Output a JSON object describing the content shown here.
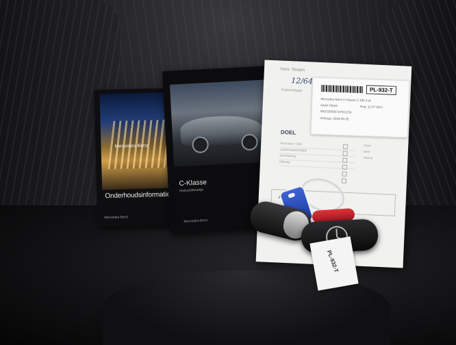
{
  "booklet_left": {
    "sign_text": "Mercedes-Benz",
    "title": "Onderhoudsinformatie",
    "footer": "Mercedes-Benz"
  },
  "booklet_right": {
    "title": "C-Klasse",
    "subtitle": "Instructieboekje",
    "footer": "Mercedes-Benz"
  },
  "paper": {
    "note": "Kenr. Straatn.",
    "handwritten": "12/649",
    "parkeer": "Parkeerplaats",
    "section_title": "DOEL",
    "rows": [
      "Inruil auto / Stel",
      "Leasemaatschappij",
      "Verzekering",
      "Opkoop"
    ],
    "right_col": [
      "Vrooi",
      "Deel",
      "Interne"
    ],
    "box_title": "AL"
  },
  "sticker": {
    "plate": "PL-932-T",
    "line1": "Mercedes-Benz C-Klasse C 200 4-dr",
    "line2": "Zwart Diesel",
    "line3": "WDD2050071F011234",
    "line4": "Verkoop: 2018-09-26",
    "date": "Reg: 11-07-2017"
  },
  "key_tag": {
    "text": "PL-932-T"
  }
}
